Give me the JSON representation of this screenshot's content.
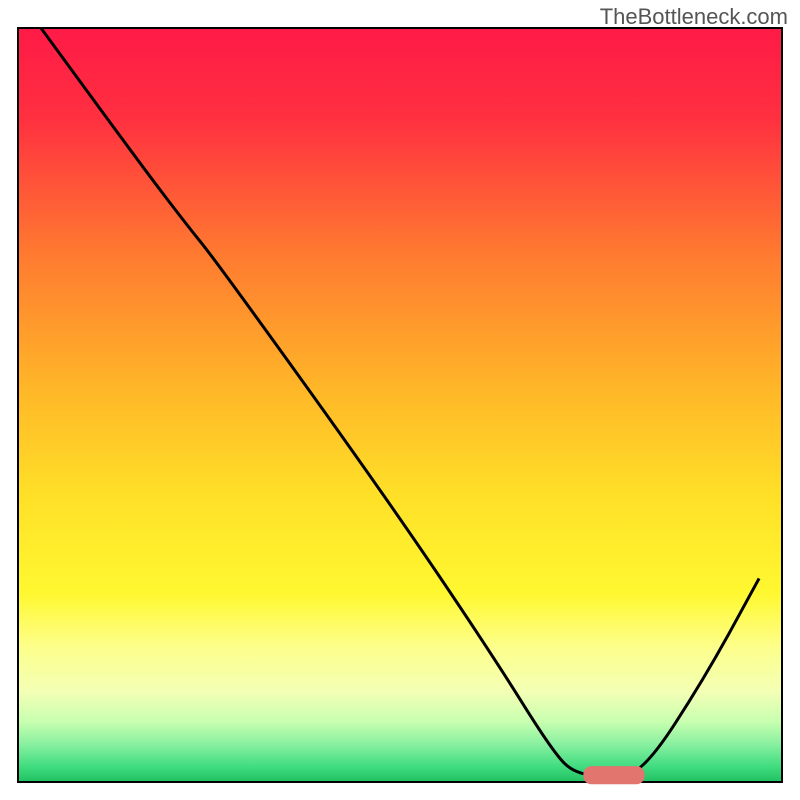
{
  "watermark": "TheBottleneck.com",
  "chart_data": {
    "type": "line",
    "title": "",
    "xlabel": "",
    "ylabel": "",
    "x_range": [
      0,
      100
    ],
    "y_range": [
      0,
      100
    ],
    "grid": false,
    "legend": false,
    "background_gradient_stops": [
      {
        "offset": 0,
        "color": "#ff1a47"
      },
      {
        "offset": 12,
        "color": "#ff3040"
      },
      {
        "offset": 30,
        "color": "#ff7a30"
      },
      {
        "offset": 48,
        "color": "#ffb728"
      },
      {
        "offset": 62,
        "color": "#ffe028"
      },
      {
        "offset": 75,
        "color": "#fff830"
      },
      {
        "offset": 82,
        "color": "#fdff8a"
      },
      {
        "offset": 88,
        "color": "#f3ffb5"
      },
      {
        "offset": 92,
        "color": "#c8ffb0"
      },
      {
        "offset": 95,
        "color": "#88f0a0"
      },
      {
        "offset": 98,
        "color": "#3fdc80"
      },
      {
        "offset": 100,
        "color": "#20c060"
      }
    ],
    "series": [
      {
        "name": "bottleneck-curve",
        "color": "#000000",
        "points": [
          {
            "x": 3,
            "y": 100
          },
          {
            "x": 16,
            "y": 82
          },
          {
            "x": 22,
            "y": 74
          },
          {
            "x": 26,
            "y": 69
          },
          {
            "x": 48,
            "y": 38
          },
          {
            "x": 62,
            "y": 17
          },
          {
            "x": 70,
            "y": 4
          },
          {
            "x": 73,
            "y": 1
          },
          {
            "x": 78,
            "y": 0.8
          },
          {
            "x": 82,
            "y": 1.5
          },
          {
            "x": 90,
            "y": 14
          },
          {
            "x": 97,
            "y": 27
          }
        ]
      }
    ],
    "marker": {
      "name": "optimal-range",
      "color": "#e2766f",
      "x_start": 74,
      "x_end": 82,
      "y": 0.9,
      "thickness": 2.4
    }
  }
}
